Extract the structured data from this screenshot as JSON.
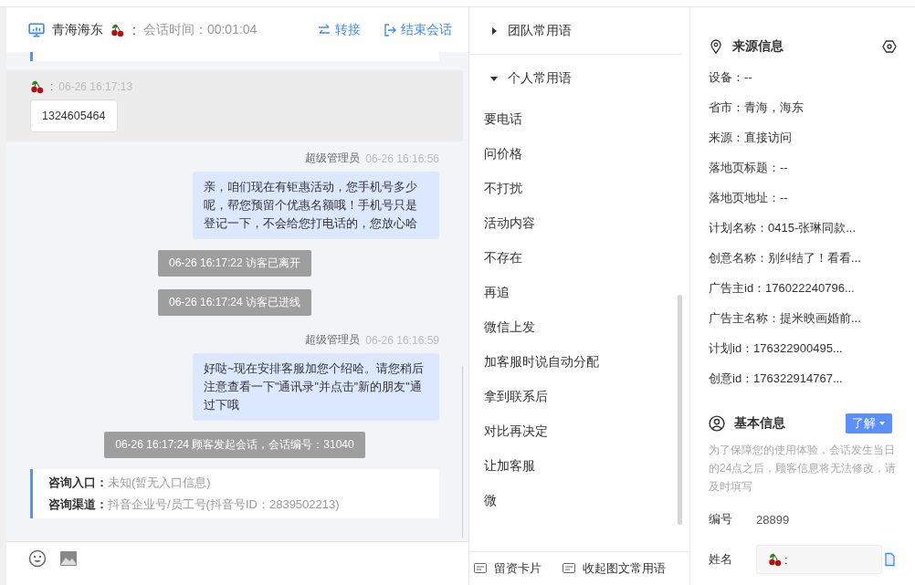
{
  "header": {
    "location": "青海海东",
    "visitor_name": ":",
    "duration": "会话时间：00:01:04",
    "actions": [
      {
        "kind": "transfer",
        "label": "转接"
      },
      {
        "kind": "end",
        "label": "结束会话"
      }
    ]
  },
  "messages": [
    {
      "kind": "clipped"
    },
    {
      "kind": "visitor",
      "highlighted": true,
      "sender": ":",
      "time": "06-26 16:17:13",
      "text": "1324605464"
    },
    {
      "kind": "agent",
      "highlighted": false,
      "sender": "超级管理员",
      "time": "06-26 16:16:56",
      "text": "亲，咱们现在有钜惠活动，您手机号多少呢，帮您预留个优惠名额哦！手机号只是登记一下，不会给您打电话的，您放心哈"
    },
    {
      "kind": "system",
      "text": "06-26 16:17:22 访客已离开"
    },
    {
      "kind": "system",
      "text": "06-26 16:17:24 访客已进线"
    },
    {
      "kind": "agent",
      "highlighted": false,
      "sender": "超级管理员",
      "time": "06-26 16:16:59",
      "text": "好哒~现在安排客服加您个绍哈。请您稍后注意查看一下\"通讯录\"并点击\"新的朋友\"通过下哦"
    },
    {
      "kind": "system",
      "text": "06-26 16:17:24 顾客发起会话，会话编号：31040"
    },
    {
      "kind": "source",
      "rows": [
        {
          "label": "咨询入口：",
          "value": "未知(暂无入口信息)"
        },
        {
          "label": "咨询渠道：",
          "value": "抖音企业号/员工号(抖音号ID：2839502213)"
        }
      ]
    }
  ],
  "composer": {
    "tools": [
      {
        "kind": "emoji"
      },
      {
        "kind": "image"
      }
    ]
  },
  "phrases": {
    "groups": [
      {
        "title": "团队常用语",
        "expanded": false
      },
      {
        "title": "个人常用语",
        "expanded": true
      }
    ],
    "items": [
      "要电话",
      "问价格",
      "不打扰",
      "活动内容",
      "不存在",
      "再追",
      "微信上发",
      "加客服时说自动分配",
      "拿到联系后",
      "对比再决定",
      "让加客服",
      "微"
    ]
  },
  "footer_tools": [
    {
      "label": "留资卡片"
    },
    {
      "label": "收起图文常用语"
    }
  ],
  "source_info": {
    "title": "来源信息",
    "fields": [
      "设备：--",
      "省市：青海，海东",
      "来源：直接访问",
      "落地页标题：--",
      "落地页地址：--",
      "计划名称：0415-张琳同款...",
      "创意名称：别纠结了！看看...",
      "广告主id：176022240796...",
      "广告主名称：提米映画婚前...",
      "计划id：176322900495...",
      "创意id：176322914767..."
    ]
  },
  "basic_info": {
    "title": "基本信息",
    "button": "了解",
    "notice": "为了保障您的使用体验，会话发生当日的24点之后，顾客信息将无法修改，请及时填写",
    "fields": [
      {
        "kind": "text",
        "label": "编号",
        "value": "28899"
      },
      {
        "kind": "input",
        "label": "姓名",
        "value": ":"
      }
    ]
  }
}
